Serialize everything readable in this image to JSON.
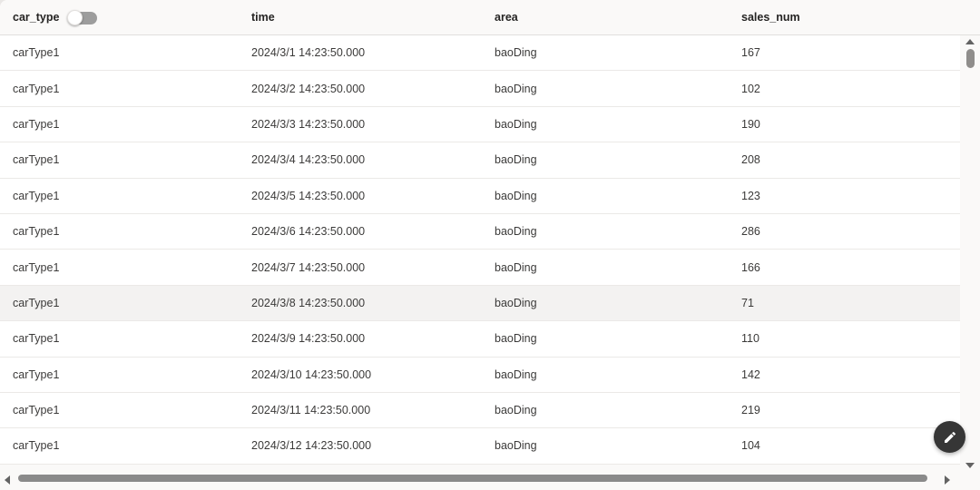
{
  "header": {
    "columns": [
      {
        "key": "car_type",
        "label": "car_type"
      },
      {
        "key": "time",
        "label": "time"
      },
      {
        "key": "area",
        "label": "area"
      },
      {
        "key": "sales_num",
        "label": "sales_num"
      }
    ],
    "toggle": {
      "field": "car_type",
      "state": "off"
    }
  },
  "table": {
    "highlighted_row": 7,
    "rows": [
      {
        "car_type": "carType1",
        "time": "2024/3/1 14:23:50.000",
        "area": "baoDing",
        "sales_num": "167"
      },
      {
        "car_type": "carType1",
        "time": "2024/3/2 14:23:50.000",
        "area": "baoDing",
        "sales_num": "102"
      },
      {
        "car_type": "carType1",
        "time": "2024/3/3 14:23:50.000",
        "area": "baoDing",
        "sales_num": "190"
      },
      {
        "car_type": "carType1",
        "time": "2024/3/4 14:23:50.000",
        "area": "baoDing",
        "sales_num": "208"
      },
      {
        "car_type": "carType1",
        "time": "2024/3/5 14:23:50.000",
        "area": "baoDing",
        "sales_num": "123"
      },
      {
        "car_type": "carType1",
        "time": "2024/3/6 14:23:50.000",
        "area": "baoDing",
        "sales_num": "286"
      },
      {
        "car_type": "carType1",
        "time": "2024/3/7 14:23:50.000",
        "area": "baoDing",
        "sales_num": "166"
      },
      {
        "car_type": "carType1",
        "time": "2024/3/8 14:23:50.000",
        "area": "baoDing",
        "sales_num": "71"
      },
      {
        "car_type": "carType1",
        "time": "2024/3/9 14:23:50.000",
        "area": "baoDing",
        "sales_num": "110"
      },
      {
        "car_type": "carType1",
        "time": "2024/3/10 14:23:50.000",
        "area": "baoDing",
        "sales_num": "142"
      },
      {
        "car_type": "carType1",
        "time": "2024/3/11 14:23:50.000",
        "area": "baoDing",
        "sales_num": "219"
      },
      {
        "car_type": "carType1",
        "time": "2024/3/12 14:23:50.000",
        "area": "baoDing",
        "sales_num": "104"
      }
    ]
  },
  "fab": {
    "icon": "pencil-edit"
  },
  "colors": {
    "header_bg": "#faf9f8",
    "row_bg": "#ffffff",
    "row_highlight": "#f3f2f1",
    "row_border": "#ebe9e7",
    "header_text": "#252423",
    "cell_text": "#3b3a39",
    "toggle_track": "#9d9d9d",
    "toggle_knob": "#ffffff",
    "fab_bg": "#363636",
    "scroll_thumb": "#8a8a8a",
    "scroll_arrow": "#636363"
  }
}
